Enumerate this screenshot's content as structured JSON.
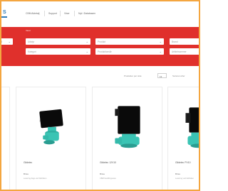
{
  "header": {
    "logo_text": "S",
    "nav": [
      "CBM Aldetalj",
      "Support",
      "Viser",
      "Nyt i Databasen"
    ]
  },
  "filters": {
    "columns": [
      {
        "label": "",
        "rows": [
          "B"
        ]
      },
      {
        "label": "Varer",
        "rows": [
          "Udstyr",
          "Kategori"
        ]
      },
      {
        "label": "",
        "rows": [
          "Produkt",
          "Produktionsår"
        ]
      },
      {
        "label": "",
        "rows": [
          "Brand",
          "Artikelnummer"
        ]
      }
    ]
  },
  "toolbar": {
    "per_page_label": "Produkter per side",
    "per_page_value": "12",
    "sort_label": "Sorteret efter"
  },
  "products": [
    {
      "name": "",
      "brand": "",
      "desc": ""
    },
    {
      "name": "Gildelec",
      "brand": "Brisa",
      "desc": "Levering dags ved fabrikken"
    },
    {
      "name": "Gildelec 12V10",
      "brand": "Brisa",
      "desc": "CBM bestillingsvare"
    },
    {
      "name": "Gildelec PV10",
      "brand": "Brisa",
      "desc": "Levering ved fabrikken"
    }
  ],
  "colors": {
    "brand_red": "#e0302c",
    "product_body": "#0a0a0a",
    "product_base": "#3ac4b4",
    "frame": "#f4a640"
  }
}
